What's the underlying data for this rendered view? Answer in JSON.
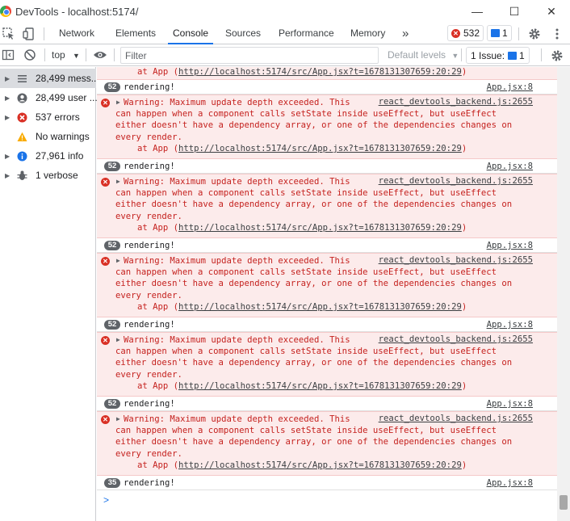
{
  "window": {
    "title": "DevTools - localhost:5174/",
    "minimize": "—",
    "maximize": "☐",
    "close": "✕"
  },
  "tabs": [
    {
      "label": "Network"
    },
    {
      "label": "Elements"
    },
    {
      "label": "Console"
    },
    {
      "label": "Sources"
    },
    {
      "label": "Performance"
    },
    {
      "label": "Memory"
    }
  ],
  "toolbar": {
    "more_tabs": "»",
    "error_count": "532",
    "message_count": "1"
  },
  "filterbar": {
    "context": "top",
    "filter_placeholder": "Filter",
    "levels": "Default levels",
    "issues_label": "1 Issue:",
    "issues_count": "1"
  },
  "sidebar": {
    "items": [
      {
        "label": "28,499 mess...",
        "icon": "list-icon"
      },
      {
        "label": "28,499 user ...",
        "icon": "user-icon"
      },
      {
        "label": "537 errors",
        "icon": "error-icon"
      },
      {
        "label": "No warnings",
        "icon": "warning-icon"
      },
      {
        "label": "27,961 info",
        "icon": "info-icon"
      },
      {
        "label": "1 verbose",
        "icon": "bug-icon"
      }
    ]
  },
  "console": {
    "top_stack": {
      "prefix": "at App (",
      "link": "http://localhost:5174/src/App.jsx?t=1678131307659:20:29",
      "suffix": ")"
    },
    "render_count": "52",
    "last_render_count": "35",
    "render_text": "rendering!",
    "render_source": "App.jsx:8",
    "warning": {
      "line1": "Warning: Maximum update depth exceeded. This",
      "line2": "can happen when a component calls setState inside useEffect, but useEffect",
      "line3": "either doesn't have a dependency array, or one of the dependencies changes on",
      "line4": "every render.",
      "source": "react_devtools_backend.js:2655",
      "stack_prefix": "at App (",
      "stack_link": "http://localhost:5174/src/App.jsx?t=1678131307659:20:29",
      "stack_suffix": ")"
    },
    "prompt": ">"
  }
}
